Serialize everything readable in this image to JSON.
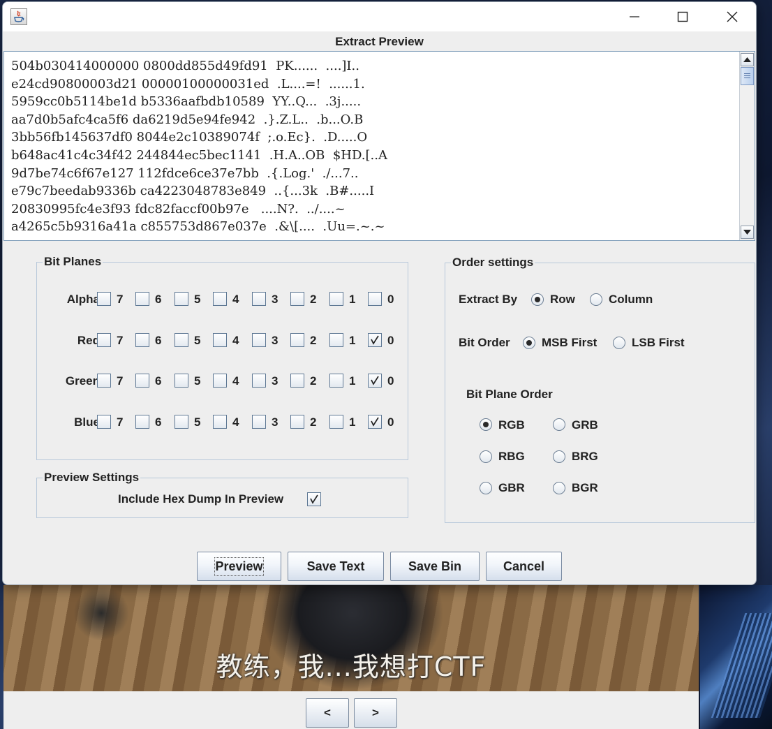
{
  "dialog": {
    "title": "Extract Preview",
    "preview_lines": [
      "504b030414000000 0800dd855d49fd91  PK......  ....]I..",
      "e24cd90800003d21 00000100000031ed  .L....=!  ......1.",
      "5959cc0b5114be1d b5336aafbdb10589  YY..Q...  .3j.....",
      "aa7d0b5afc4ca5f6 da6219d5e94fe942  .}.Z.L..  .b...O.B",
      "3bb56fb145637df0 8044e2c10389074f  ;.o.Ec}.  .D.....O",
      "b648ac41c4c34f42 244844ec5bec1141  .H.A..OB  $HD.[..A",
      "9d7be74c6f67e127 112fdce6ce37e7bb  .{.Log.'  ./...7..",
      "e79c7beedab9336b ca4223048783e849  ..{...3k  .B#.....I",
      "20830995fc4e3f93 fdc82faccf00b97e   ....N?.  ../....~",
      "a4265c5b9316a41a c855753d867e037e  .&\\[....  .Uu=.~.~"
    ]
  },
  "bit_planes": {
    "label": "Bit Planes",
    "bits": [
      "7",
      "6",
      "5",
      "4",
      "3",
      "2",
      "1",
      "0"
    ],
    "rows": [
      {
        "name": "Alpha",
        "checked": [
          false,
          false,
          false,
          false,
          false,
          false,
          false,
          false
        ]
      },
      {
        "name": "Red",
        "checked": [
          false,
          false,
          false,
          false,
          false,
          false,
          false,
          true
        ]
      },
      {
        "name": "Green",
        "checked": [
          false,
          false,
          false,
          false,
          false,
          false,
          false,
          true
        ]
      },
      {
        "name": "Blue",
        "checked": [
          false,
          false,
          false,
          false,
          false,
          false,
          false,
          true
        ]
      }
    ]
  },
  "preview_settings": {
    "label": "Preview Settings",
    "include_hex_label": "Include Hex Dump In Preview",
    "include_hex_checked": true
  },
  "order_settings": {
    "label": "Order settings",
    "extract_by_label": "Extract By",
    "extract_by_options": [
      "Row",
      "Column"
    ],
    "extract_by_selected": "Row",
    "bit_order_label": "Bit Order",
    "bit_order_options": [
      "MSB First",
      "LSB First"
    ],
    "bit_order_selected": "MSB First",
    "bit_plane_order_label": "Bit Plane Order",
    "bit_plane_order_options": [
      "RGB",
      "GRB",
      "RBG",
      "BRG",
      "GBR",
      "BGR"
    ],
    "bit_plane_order_selected": "RGB"
  },
  "buttons": {
    "preview": "Preview",
    "save_text": "Save Text",
    "save_bin": "Save Bin",
    "cancel": "Cancel"
  },
  "background_window": {
    "caption": "教练，我...我想打CTF",
    "prev_label": "<",
    "next_label": ">"
  },
  "colors": {
    "dialog_bg": "#eeeeee",
    "group_border": "#b8c8da",
    "preview_border": "#7f9db9"
  }
}
